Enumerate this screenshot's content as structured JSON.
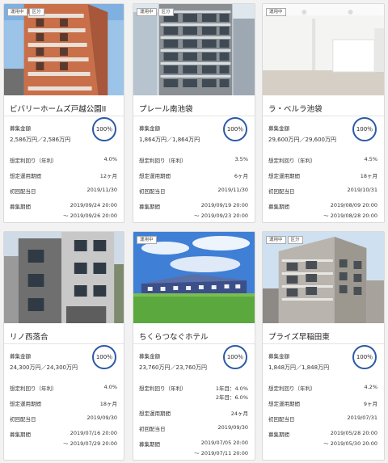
{
  "cards": [
    {
      "badges": [
        "運用中",
        "区分"
      ],
      "name": "ビバリーホームズ戸越公園II",
      "amount_label": "募集金額",
      "amount": "2,586万円／2,586万円",
      "progress": "100％",
      "progress_value": 100,
      "yield_label": "想定利回り（年利）",
      "yield": "4.0%",
      "yield2": "",
      "term_label": "想定運用期間",
      "term": "12ヶ月",
      "dividend_label": "初回配当日",
      "dividend": "2019/11/30",
      "period_label": "募集期間",
      "period_start": "2019/09/24 20:00",
      "period_end": "〜 2019/09/26 20:00"
    },
    {
      "badges": [
        "運用中",
        "区分"
      ],
      "name": "プレール南池袋",
      "amount_label": "募集金額",
      "amount": "1,864万円／1,864万円",
      "progress": "100％",
      "progress_value": 100,
      "yield_label": "想定利回り（年利）",
      "yield": "3.5%",
      "yield2": "",
      "term_label": "想定運用期間",
      "term": "6ヶ月",
      "dividend_label": "初回配当日",
      "dividend": "2019/11/30",
      "period_label": "募集期間",
      "period_start": "2019/09/19 20:00",
      "period_end": "〜 2019/09/23 20:00"
    },
    {
      "badges": [
        "運用中"
      ],
      "name": "ラ・ベルラ池袋",
      "amount_label": "募集金額",
      "amount": "29,600万円／29,600万円",
      "progress": "100％",
      "progress_value": 100,
      "yield_label": "想定利回り（年利）",
      "yield": "4.5%",
      "yield2": "",
      "term_label": "想定運用期間",
      "term": "18ヶ月",
      "dividend_label": "初回配当日",
      "dividend": "2019/10/31",
      "period_label": "募集期間",
      "period_start": "2019/08/09 20:00",
      "period_end": "〜 2019/08/28 20:00"
    },
    {
      "badges": [],
      "name": "リノ西落合",
      "amount_label": "募集金額",
      "amount": "24,300万円／24,300万円",
      "progress": "100％",
      "progress_value": 100,
      "yield_label": "想定利回り（年利）",
      "yield": "4.0%",
      "yield2": "",
      "term_label": "想定運用期間",
      "term": "18ヶ月",
      "dividend_label": "初回配当日",
      "dividend": "2019/09/30",
      "period_label": "募集期間",
      "period_start": "2019/07/16 20:00",
      "period_end": "〜 2019/07/29 20:00"
    },
    {
      "badges": [
        "運用中"
      ],
      "name": "ちくらつなぐホテル",
      "amount_label": "募集金額",
      "amount": "23,760万円／23,760万円",
      "progress": "100％",
      "progress_value": 100,
      "yield_label": "想定利回り（年利）",
      "yield": "1年目：4.0%",
      "yield2": "2年目：6.0%",
      "term_label": "想定運用期間",
      "term": "24ヶ月",
      "dividend_label": "初回配当日",
      "dividend": "2019/09/30",
      "period_label": "募集期間",
      "period_start": "2019/07/05 20:00",
      "period_end": "〜 2019/07/11 20:00"
    },
    {
      "badges": [
        "運用中",
        "区分"
      ],
      "name": "プライズ早稲田東",
      "amount_label": "募集金額",
      "amount": "1,848万円／1,848万円",
      "progress": "100％",
      "progress_value": 100,
      "yield_label": "想定利回り（年利）",
      "yield": "4.2%",
      "yield2": "",
      "term_label": "想定運用期間",
      "term": "9ヶ月",
      "dividend_label": "初回配当日",
      "dividend": "2019/07/31",
      "period_label": "募集期間",
      "period_start": "2019/05/28 20:00",
      "period_end": "〜 2019/05/30 20:00"
    }
  ],
  "colors": {
    "ring": "#2b5aa6",
    "border": "#dadada"
  }
}
